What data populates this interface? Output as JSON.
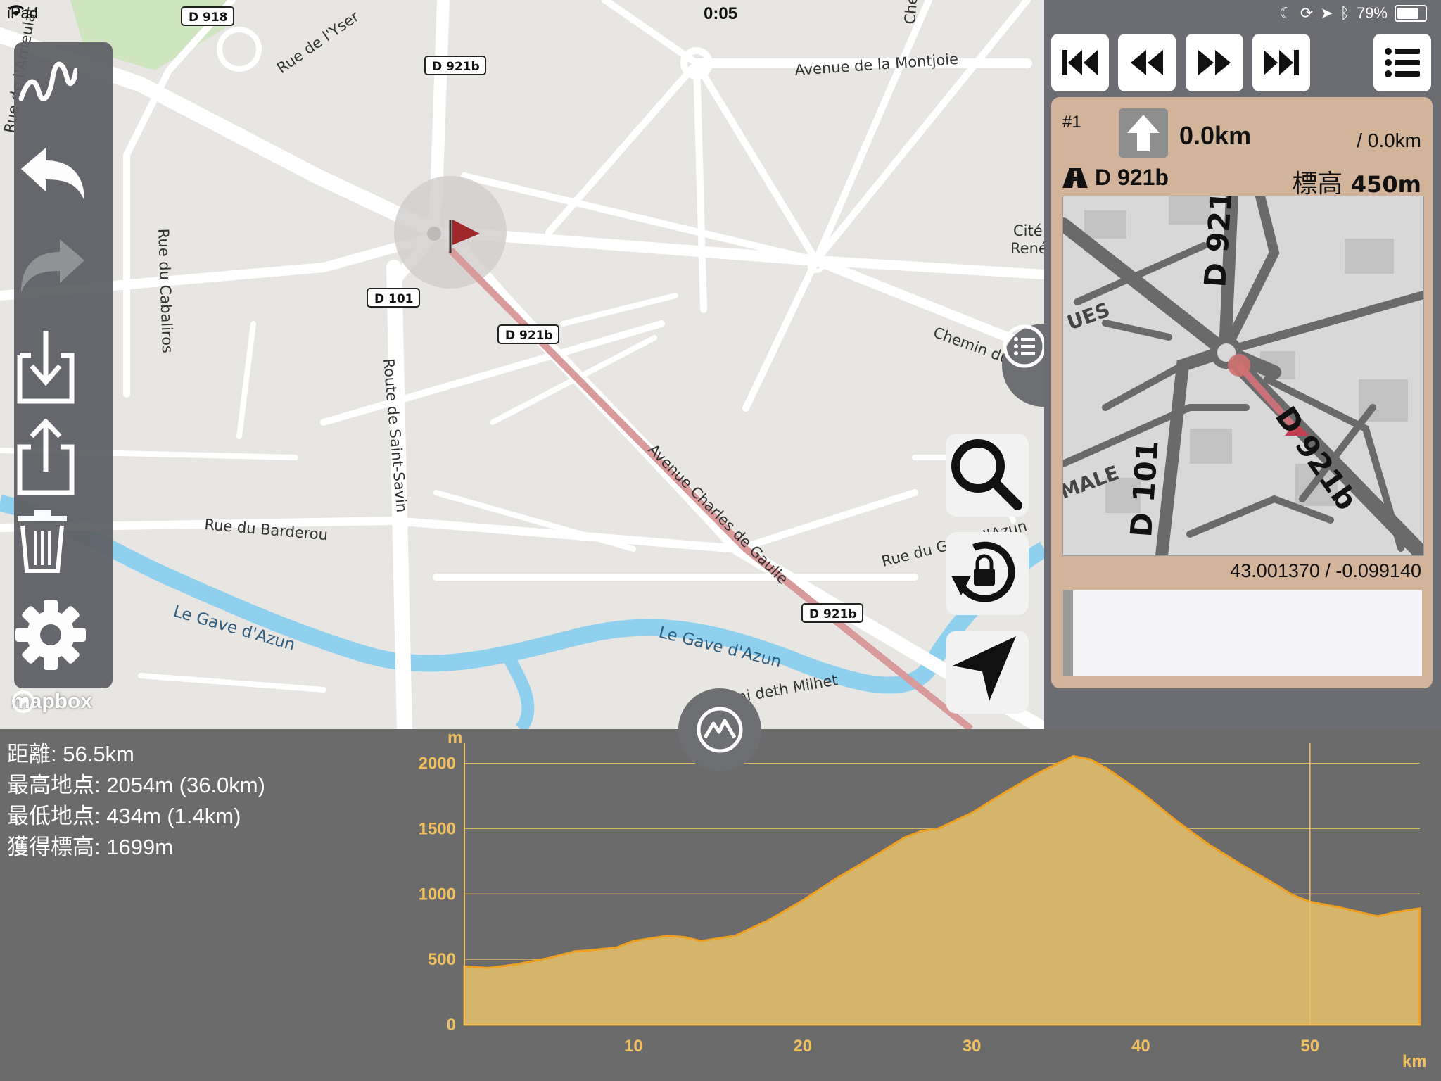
{
  "status_bar": {
    "device": "iPad",
    "time": "0:05",
    "battery": "79%",
    "battery_level": 0.79
  },
  "map": {
    "attribution": "mapbox",
    "road_labels": {
      "rue_yser": "Rue de l'Yser",
      "avenue_montjoie": "Avenue de la Montjoie",
      "rue_cabaliros": "Rue du Cabaliros",
      "route_saint_savin": "Route de Saint-Savin",
      "rue_barderou": "Rue du Barderou",
      "avenue_cdg": "Avenue Charles de Gaulle",
      "chemin_lys": "Chemin du Lys",
      "rue_gave": "Rue du Gave d'Azun",
      "cami_milhet": "Cami deth Milhet",
      "arrieulat": "Rue de l'Arrieulat",
      "che": "Che",
      "cite": "Cité",
      "rene": "René"
    },
    "river_labels": {
      "left": "Le Gave d'Azun",
      "right": "Le Gave d'Azun"
    },
    "shields": {
      "d918": "D 918",
      "d921b_top": "D 921b",
      "d101": "D 101",
      "d921b_mid": "D 921b",
      "d921b_bottom": "D 921b"
    }
  },
  "toolbar": {
    "items": [
      {
        "name": "draw-route",
        "icon": "squiggle-icon"
      },
      {
        "name": "undo",
        "icon": "undo-icon"
      },
      {
        "name": "redo",
        "icon": "redo-icon"
      },
      {
        "name": "import",
        "icon": "download-icon"
      },
      {
        "name": "export",
        "icon": "share-icon"
      },
      {
        "name": "delete",
        "icon": "trash-icon"
      },
      {
        "name": "settings",
        "icon": "gear-icon"
      }
    ]
  },
  "media_controls": [
    "skip-to-start-icon",
    "rewind-icon",
    "fast-forward-icon",
    "skip-to-end-icon",
    "list-icon"
  ],
  "waypoint_card": {
    "index": "#1",
    "distance": "0.0km",
    "total": "/ 0.0km",
    "road": "D 921b",
    "elevation_label": "標高",
    "elevation_value": "450m",
    "coordinates": "43.001370 / -0.099140",
    "minimap_labels": {
      "d921b_a": "D 921b",
      "d921b_b": "D 921b",
      "d101": "D 101",
      "ues": "UES",
      "male": "MALE"
    }
  },
  "stats": {
    "distance": "距離: 56.5km",
    "highest": "最高地点: 2054m (36.0km)",
    "lowest": "最低地点: 434m (1.4km)",
    "gain": "獲得標高: 1699m"
  },
  "chart_data": {
    "type": "area",
    "xlabel": "km",
    "ylabel": "m",
    "xlim": [
      0,
      56.5
    ],
    "ylim": [
      0,
      2100
    ],
    "x_ticks": [
      "10",
      "20",
      "30",
      "40",
      "50"
    ],
    "y_ticks": [
      "0",
      "500",
      "1000",
      "1500",
      "2000"
    ],
    "grid": true,
    "marker_x": 50,
    "series": [
      {
        "x": [
          0,
          1.4,
          3,
          5,
          6.5,
          7.5,
          9,
          10,
          11,
          12,
          13,
          14,
          16,
          18,
          20,
          22,
          24,
          26,
          27,
          28,
          30,
          32,
          34,
          36,
          37,
          38,
          40,
          42,
          44,
          46,
          48,
          49,
          50,
          52,
          54,
          55,
          56.5
        ],
        "y": [
          445,
          434,
          460,
          510,
          560,
          570,
          590,
          640,
          660,
          680,
          670,
          640,
          680,
          800,
          950,
          1120,
          1270,
          1430,
          1480,
          1500,
          1620,
          1780,
          1930,
          2054,
          2030,
          1960,
          1780,
          1570,
          1380,
          1220,
          1070,
          990,
          940,
          890,
          830,
          860,
          890
        ]
      }
    ]
  },
  "colors": {
    "route": "#d89a9a",
    "flag": "#a0282a",
    "water": "#8ed0ee",
    "chart_fill": "#d5b56c",
    "chart_line": "#f0a020",
    "card_bg": "#d2b49b"
  }
}
